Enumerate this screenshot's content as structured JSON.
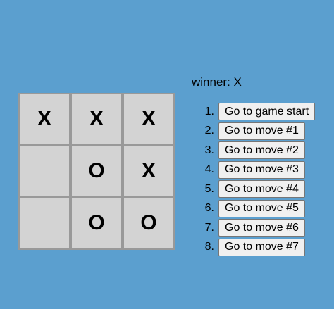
{
  "game": {
    "status": "winner: X",
    "squares": [
      "X",
      "X",
      "X",
      "",
      "O",
      "X",
      "",
      "O",
      "O"
    ]
  },
  "moves": [
    {
      "number": "1.",
      "label": "Go to game start"
    },
    {
      "number": "2.",
      "label": "Go to move #1"
    },
    {
      "number": "3.",
      "label": "Go to move #2"
    },
    {
      "number": "4.",
      "label": "Go to move #3"
    },
    {
      "number": "5.",
      "label": "Go to move #4"
    },
    {
      "number": "6.",
      "label": "Go to move #5"
    },
    {
      "number": "7.",
      "label": "Go to move #6"
    },
    {
      "number": "8.",
      "label": "Go to move #7"
    }
  ],
  "colors": {
    "background": "#5b9fcf",
    "square": "#d3d3d3",
    "grid": "#999999"
  }
}
